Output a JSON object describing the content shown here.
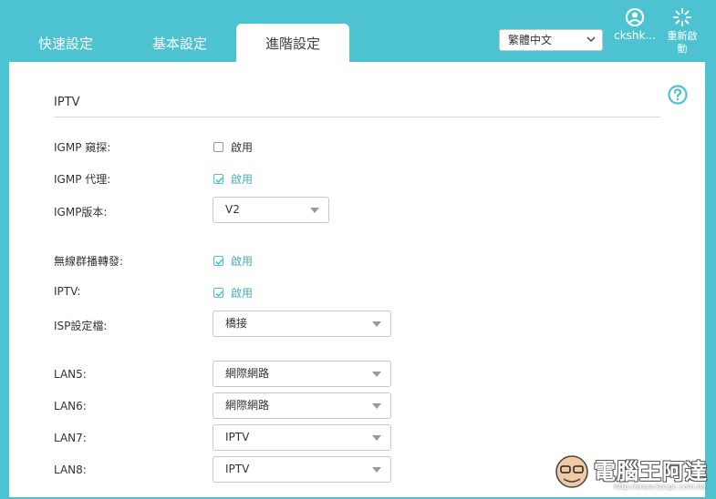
{
  "tabs": [
    {
      "label": "快速設定"
    },
    {
      "label": "基本設定"
    },
    {
      "label": "進階設定"
    }
  ],
  "language": {
    "value": "繁體中文"
  },
  "account": {
    "label": "ckshk..."
  },
  "reboot": {
    "label_line1": "重新啟",
    "label_line2": "動"
  },
  "section": {
    "title": "IPTV"
  },
  "rows": {
    "igmp_snooping": {
      "label": "IGMP 窺探:",
      "option": "啟用",
      "checked": false
    },
    "igmp_proxy": {
      "label": "IGMP 代理:",
      "option": "啟用",
      "checked": true
    },
    "igmp_version": {
      "label": "IGMP版本:",
      "value": "V2"
    },
    "wireless_multicast": {
      "label": "無線群播轉發:",
      "option": "啟用",
      "checked": true
    },
    "iptv": {
      "label": "IPTV:",
      "option": "啟用",
      "checked": true
    },
    "isp_profile": {
      "label": "ISP設定檔:",
      "value": "橋接"
    },
    "lan5": {
      "label": "LAN5:",
      "value": "網際網路"
    },
    "lan6": {
      "label": "LAN6:",
      "value": "網際網路"
    },
    "lan7": {
      "label": "LAN7:",
      "value": "IPTV"
    },
    "lan8": {
      "label": "LAN8:",
      "value": "IPTV"
    }
  },
  "watermark": {
    "title": "電腦王阿達",
    "url": "http://www.kocpc.com.tw"
  },
  "colors": {
    "accent": "#4dc3d1",
    "check_text": "#4aa9b4"
  }
}
